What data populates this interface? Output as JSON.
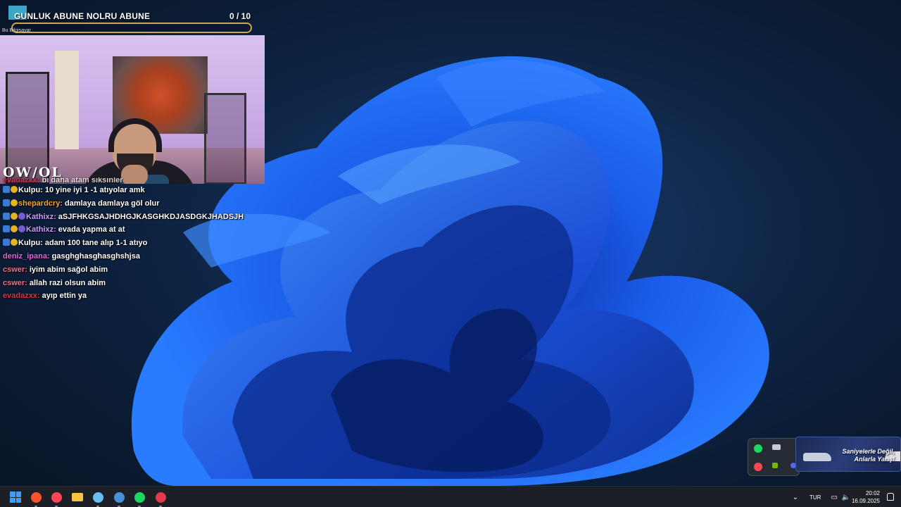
{
  "subgoal": {
    "title": "GUNLUK ABUNE NOLRU ABUNE",
    "count": "0  / 10",
    "progress_fraction": 0,
    "small_text": "Bu Bilgisayar"
  },
  "webcam": {
    "overlay_logo": "OW/OL"
  },
  "chat": {
    "messages": [
      {
        "user": "evadazxx:",
        "text": "bi daha atam siksinler",
        "user_color": "#e0314b",
        "badges": [],
        "cut": true
      },
      {
        "user": "Kulpu:",
        "text": "10 yine iyi 1 -1 atıyolar amk",
        "user_color": "#ffffff",
        "badges": [
          "a",
          "b"
        ]
      },
      {
        "user": "shepardcry:",
        "text": "damlaya damlaya göl olur",
        "user_color": "#ff9f2e",
        "badges": [
          "a",
          "b"
        ]
      },
      {
        "user": "Kathixz:",
        "text": "aSJFHKGSAJHDHGJKASGHKDJASDGKJHADSJH",
        "user_color": "#c8a0ff",
        "badges": [
          "a",
          "b",
          "c"
        ]
      },
      {
        "user": "Kathixz:",
        "text": "evada yapma at at",
        "user_color": "#c8a0ff",
        "badges": [
          "a",
          "b",
          "c"
        ]
      },
      {
        "user": "Kulpu:",
        "text": "adam 100 tane alıp 1-1 atıyo",
        "user_color": "#ffffff",
        "badges": [
          "a",
          "b"
        ]
      },
      {
        "user": "deniz_ipana:",
        "text": "gasghghasghasghshjsa",
        "user_color": "#e066e0",
        "badges": []
      },
      {
        "user": "cswer:",
        "text": "iyim abim sağol abim",
        "user_color": "#ff6a8a",
        "badges": []
      },
      {
        "user": "cswer:",
        "text": "allah razi olsun abim",
        "user_color": "#ff6a8a",
        "badges": []
      },
      {
        "user": "evadazxx:",
        "text": "ayıp ettin ya",
        "user_color": "#e0314b",
        "badges": []
      }
    ]
  },
  "promo": {
    "line1": "Saniyelerle Değil,",
    "line2": "Anlarla Yarış!"
  },
  "taskbar": {
    "apps": [
      {
        "name": "start-button",
        "icon": "windows-logo",
        "color": "#3aa0ff"
      },
      {
        "name": "brave-browser-button",
        "icon": "brave-lion",
        "color": "#fb542b"
      },
      {
        "name": "valorant-launcher-button",
        "icon": "riot-pin",
        "color": "#ff4655"
      },
      {
        "name": "file-explorer-button",
        "icon": "folder",
        "color": "#f6c343"
      },
      {
        "name": "steam-button",
        "icon": "steam",
        "color": "#66c0f4"
      },
      {
        "name": "browser-button",
        "icon": "globe",
        "color": "#4a90d9"
      },
      {
        "name": "spotify-button",
        "icon": "spotify",
        "color": "#1ed760"
      },
      {
        "name": "mail-button",
        "icon": "mail",
        "color": "#e03a4e"
      }
    ],
    "language": "TUR",
    "time": "20:02",
    "date": "16.09.2025"
  }
}
